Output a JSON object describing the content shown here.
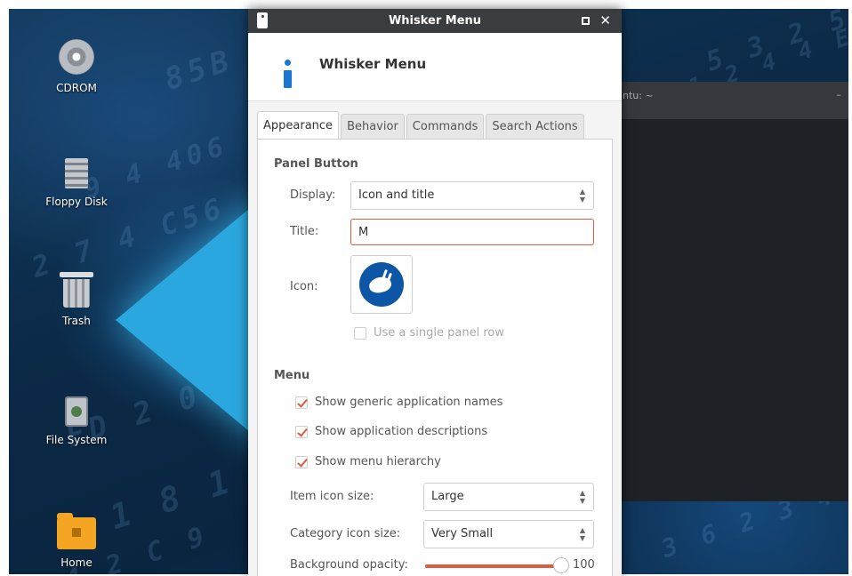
{
  "desktop": {
    "icons": [
      {
        "label": "CDROM",
        "icon": "cdrom-icon"
      },
      {
        "label": "Floppy Disk",
        "icon": "floppy-disk-icon"
      },
      {
        "label": "Trash",
        "icon": "trash-icon"
      },
      {
        "label": "File System",
        "icon": "file-system-icon"
      },
      {
        "label": "Home",
        "icon": "home-folder-icon"
      }
    ]
  },
  "terminal": {
    "title": "ntu: ~",
    "control": "–"
  },
  "dialog": {
    "window_title": "Whisker Menu",
    "header_title": "Whisker Menu",
    "tabs": [
      {
        "label": "Appearance",
        "active": true
      },
      {
        "label": "Behavior",
        "active": false
      },
      {
        "label": "Commands",
        "active": false
      },
      {
        "label": "Search Actions",
        "active": false
      }
    ],
    "panel_button": {
      "section_title": "Panel Button",
      "display_label": "Display:",
      "display_value": "Icon and title",
      "title_label": "Title:",
      "title_value": "M",
      "icon_label": "Icon:",
      "single_row_label": "Use a single panel row",
      "single_row_checked": false
    },
    "menu": {
      "section_title": "Menu",
      "checkboxes": [
        {
          "label": "Show generic application names",
          "checked": true
        },
        {
          "label": "Show application descriptions",
          "checked": true
        },
        {
          "label": "Show menu hierarchy",
          "checked": true
        }
      ],
      "item_icon_size_label": "Item icon size:",
      "item_icon_size_value": "Large",
      "category_icon_size_label": "Category icon size:",
      "category_icon_size_value": "Very Small",
      "background_opacity_label": "Background opacity:",
      "background_opacity_value": "100"
    }
  },
  "colors": {
    "accent": "#e05a3e",
    "titlebar": "#3a3d40",
    "info_blue": "#1976d2",
    "xfce_blue": "#0d56a6"
  }
}
